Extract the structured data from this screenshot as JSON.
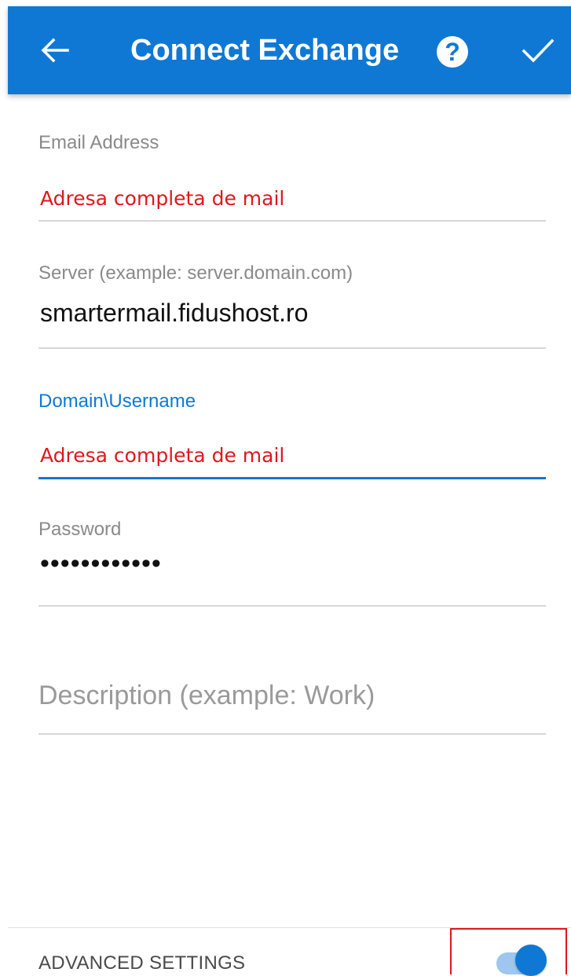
{
  "appbar": {
    "title": "Connect Exchange",
    "back_icon": "arrow-left-icon",
    "help_icon": "help-circle-icon",
    "help_glyph": "?",
    "confirm_icon": "check-icon",
    "color": "#0f78d4"
  },
  "form": {
    "email": {
      "label": "Email Address",
      "annotation": "Adresa completa de mail"
    },
    "server": {
      "label": "Server (example: server.domain.com)",
      "value": "smartermail.fidushost.ro"
    },
    "username": {
      "label": "Domain\\Username",
      "annotation": "Adresa completa de mail"
    },
    "password": {
      "label": "Password",
      "value": "••••••••••••"
    },
    "description": {
      "placeholder": "Description (example: Work)"
    }
  },
  "advanced": {
    "label": "ADVANCED SETTINGS",
    "toggle_on": true,
    "highlight_color": "#e0171d"
  }
}
